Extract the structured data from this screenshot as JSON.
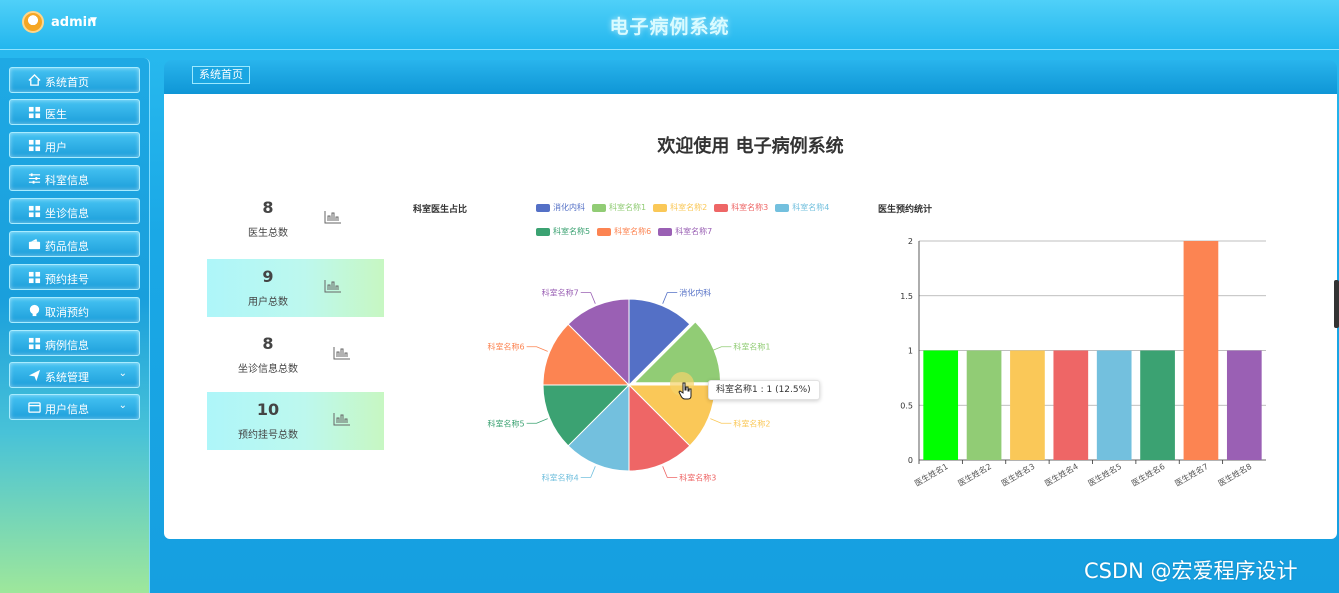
{
  "header": {
    "user_name": "admin",
    "title": "电子病例系统"
  },
  "sidebar": {
    "items": [
      {
        "label": "系统首页",
        "icon": "home-icon"
      },
      {
        "label": "医生",
        "icon": "grid-icon"
      },
      {
        "label": "用户",
        "icon": "grid-icon"
      },
      {
        "label": "科室信息",
        "icon": "sliders-icon"
      },
      {
        "label": "坐诊信息",
        "icon": "grid-icon"
      },
      {
        "label": "药品信息",
        "icon": "wallet-icon"
      },
      {
        "label": "预约挂号",
        "icon": "grid-icon"
      },
      {
        "label": "取消预约",
        "icon": "bulb-icon"
      },
      {
        "label": "病例信息",
        "icon": "grid-icon"
      },
      {
        "label": "系统管理",
        "icon": "send-icon"
      },
      {
        "label": "用户信息",
        "icon": "card-icon"
      }
    ]
  },
  "breadcrumb": {
    "label": "系统首页"
  },
  "main": {
    "welcome": "欢迎使用 电子病例系统",
    "stats": [
      {
        "value": "8",
        "label": "医生总数"
      },
      {
        "value": "9",
        "label": "用户总数"
      },
      {
        "value": "8",
        "label": "坐诊信息总数"
      },
      {
        "value": "10",
        "label": "预约挂号总数"
      }
    ],
    "tooltip": "科室名称1 : 1 (12.5%)"
  },
  "watermark": "CSDN @宏爱程序设计",
  "colors": {
    "c0": "#5470c6",
    "c1": "#91cc75",
    "c2": "#fac858",
    "c3": "#ee6666",
    "c4": "#73c0de",
    "c5": "#3ba272",
    "c6": "#fc8452",
    "c7": "#9a60b4",
    "bar0": "#00ff00"
  },
  "chart_data": [
    {
      "type": "pie",
      "title": "科室医生占比",
      "legend": [
        "消化内科",
        "科室名称1",
        "科室名称2",
        "科室名称3",
        "科室名称4",
        "科室名称5",
        "科室名称6",
        "科室名称7"
      ],
      "categories": [
        "消化内科",
        "科室名称1",
        "科室名称2",
        "科室名称3",
        "科室名称4",
        "科室名称5",
        "科室名称6",
        "科室名称7"
      ],
      "values": [
        1,
        1,
        1,
        1,
        1,
        1,
        1,
        1
      ],
      "legend_position": "top"
    },
    {
      "type": "bar",
      "title": "医生预约统计",
      "categories": [
        "医生姓名1",
        "医生姓名2",
        "医生姓名3",
        "医生姓名4",
        "医生姓名5",
        "医生姓名6",
        "医生姓名7",
        "医生姓名8"
      ],
      "values": [
        1,
        1,
        1,
        1,
        1,
        1,
        2,
        1
      ],
      "ylim": [
        0,
        2
      ],
      "yticks": [
        "0",
        "0.5",
        "1",
        "1.5",
        "2"
      ],
      "grid": true
    }
  ]
}
